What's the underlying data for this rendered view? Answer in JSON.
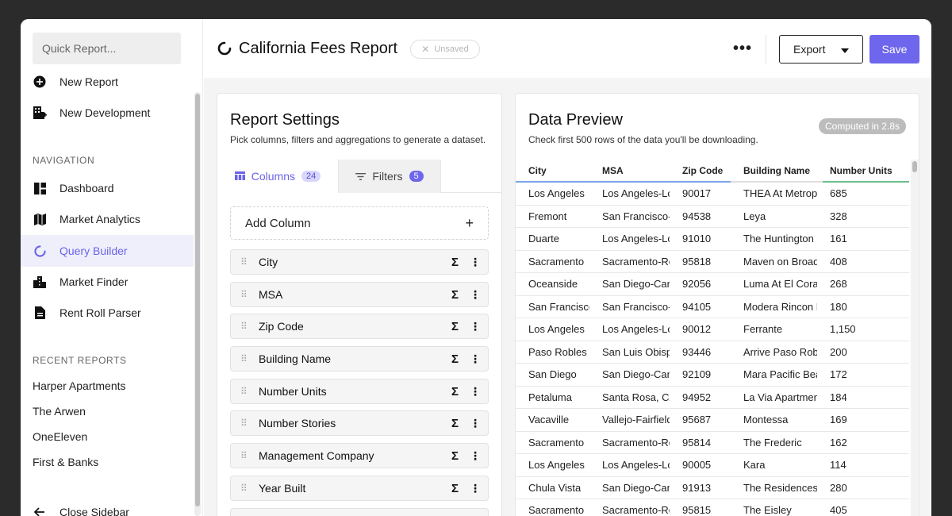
{
  "sidebar": {
    "quick_report_placeholder": "Quick Report...",
    "actions": [
      {
        "label": "New Report",
        "icon": "plus-circle-icon"
      },
      {
        "label": "New Development",
        "icon": "building-add-icon"
      }
    ],
    "navigation_heading": "NAVIGATION",
    "nav": [
      {
        "label": "Dashboard",
        "icon": "dashboard-icon",
        "active": false
      },
      {
        "label": "Market Analytics",
        "icon": "map-icon",
        "active": false
      },
      {
        "label": "Query Builder",
        "icon": "spinner-icon",
        "active": true
      },
      {
        "label": "Market Finder",
        "icon": "city-icon",
        "active": false
      },
      {
        "label": "Rent Roll Parser",
        "icon": "document-icon",
        "active": false
      }
    ],
    "recent_heading": "RECENT REPORTS",
    "recent": [
      "Harper Apartments",
      "The Arwen",
      "OneEleven",
      "First & Banks"
    ],
    "close_label": "Close Sidebar"
  },
  "header": {
    "title": "California Fees Report",
    "status": "Unsaved",
    "export_label": "Export",
    "save_label": "Save",
    "accent": "#6e66ec"
  },
  "settings": {
    "title": "Report Settings",
    "subtitle": "Pick columns, filters and aggregations to generate a dataset.",
    "tabs": [
      {
        "label": "Columns",
        "count": "24"
      },
      {
        "label": "Filters",
        "count": "5"
      }
    ],
    "add_column_label": "Add Column",
    "columns": [
      "City",
      "MSA",
      "Zip Code",
      "Building Name",
      "Number Units",
      "Number Stories",
      "Management Company",
      "Year Built"
    ]
  },
  "preview": {
    "title": "Data Preview",
    "subtitle": "Check first 500 rows of the data you'll be downloading.",
    "computed": "Computed in 2.8s",
    "headers": [
      "City",
      "MSA",
      "Zip Code",
      "Building Name",
      "Number Units"
    ],
    "rows": [
      [
        "Los Angeles",
        "Los Angeles-Long Beach",
        "90017",
        "THEA At Metropolis",
        "685"
      ],
      [
        "Fremont",
        "San Francisco-Oakland",
        "94538",
        "Leya",
        "328"
      ],
      [
        "Duarte",
        "Los Angeles-Long Beach",
        "91010",
        "The Huntington",
        "161"
      ],
      [
        "Sacramento",
        "Sacramento-Roseville",
        "95818",
        "Maven on Broadway",
        "408"
      ],
      [
        "Oceanside",
        "San Diego-Carlsbad",
        "92056",
        "Luma At El Corazon",
        "268"
      ],
      [
        "San Francisco",
        "San Francisco-Oakland",
        "94105",
        "Modera Rincon Hill",
        "180"
      ],
      [
        "Los Angeles",
        "Los Angeles-Long Beach",
        "90012",
        "Ferrante",
        "1,150"
      ],
      [
        "Paso Robles",
        "San Luis Obispo",
        "93446",
        "Arrive Paso Robles",
        "200"
      ],
      [
        "San Diego",
        "San Diego-Carlsbad",
        "92109",
        "Mara Pacific Beach",
        "172"
      ],
      [
        "Petaluma",
        "Santa Rosa, CA",
        "94952",
        "La Via Apartments",
        "184"
      ],
      [
        "Vacaville",
        "Vallejo-Fairfield",
        "95687",
        "Montessa",
        "169"
      ],
      [
        "Sacramento",
        "Sacramento-Roseville",
        "95814",
        "The Frederic",
        "162"
      ],
      [
        "Los Angeles",
        "Los Angeles-Long Beach",
        "90005",
        "Kara",
        "114"
      ],
      [
        "Chula Vista",
        "San Diego-Carlsbad",
        "91913",
        "The Residences",
        "280"
      ],
      [
        "Sacramento",
        "Sacramento-Roseville",
        "95815",
        "The Eisley",
        "405"
      ]
    ]
  }
}
